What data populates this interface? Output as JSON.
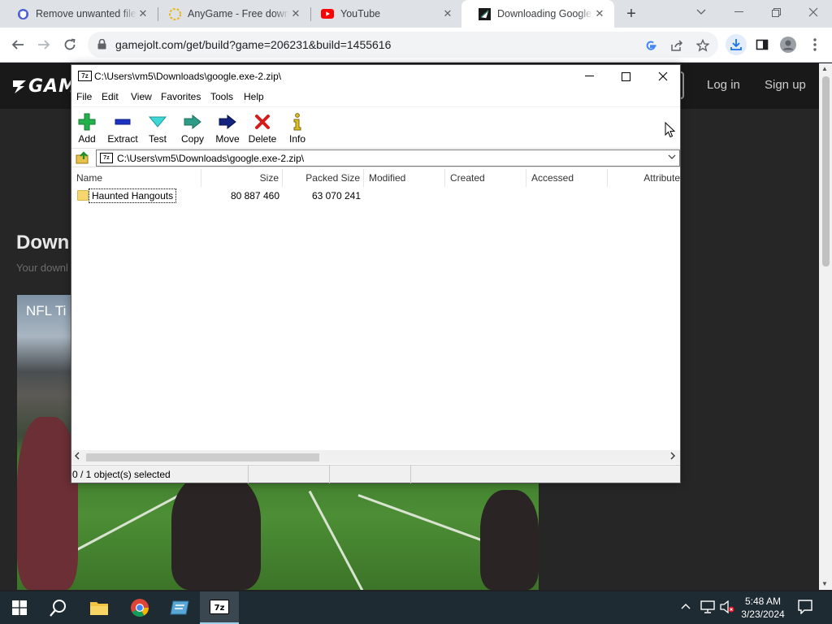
{
  "browser": {
    "tabs": [
      {
        "title": "Remove unwanted files",
        "active": false
      },
      {
        "title": "AnyGame - Free downl",
        "active": false
      },
      {
        "title": "YouTube",
        "active": false
      },
      {
        "title": "Downloading Google.e",
        "active": true
      }
    ],
    "url": "gamejolt.com/get/build?game=206231&build=1455616"
  },
  "page": {
    "logo": "GAM",
    "login": "Log in",
    "signup": "Sign up",
    "title": "Down",
    "subtitle": "Your downl",
    "video_title": "NFL Ti"
  },
  "sevenzip": {
    "title": "C:\\Users\\vm5\\Downloads\\google.exe-2.zip\\",
    "menu": [
      "File",
      "Edit",
      "View",
      "Favorites",
      "Tools",
      "Help"
    ],
    "toolbar": [
      "Add",
      "Extract",
      "Test",
      "Copy",
      "Move",
      "Delete",
      "Info"
    ],
    "address": "C:\\Users\\vm5\\Downloads\\google.exe-2.zip\\",
    "columns": [
      "Name",
      "Size",
      "Packed Size",
      "Modified",
      "Created",
      "Accessed",
      "Attribute"
    ],
    "rows": [
      {
        "name": "Haunted Hangouts",
        "size": "80 887 460",
        "packed": "63 070 241",
        "modified": "",
        "created": "",
        "accessed": "",
        "attributes": ""
      }
    ],
    "status": "0 / 1 object(s) selected"
  },
  "taskbar": {
    "time": "5:48 AM",
    "date": "3/23/2024"
  },
  "colors": {
    "chrome_tabbar": "#dee1e6",
    "taskbar": "#1f2b33",
    "page_bg": "#262626",
    "youtube_red": "#ff0000"
  }
}
